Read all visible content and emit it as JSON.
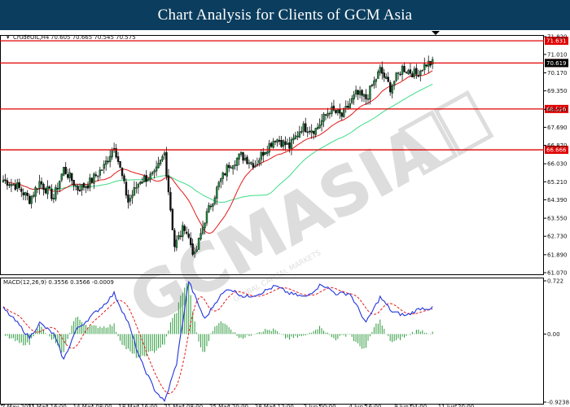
{
  "header": {
    "title": "Chart Analysis for Clients of GCM Asia"
  },
  "instrument": {
    "label": "CrudeOIL,H4",
    "ohlc": "70.605 70.665 70.545 70.575"
  },
  "macd": {
    "label": "MACD(12,26,9) 0.3556 0.3566 -0.0009"
  },
  "watermark": {
    "text": "GCMASIA",
    "sub": "GLOBAL CAPITAL MARKETS"
  },
  "chart_data": {
    "type": "candlestick",
    "title": "Chart Analysis for Clients of GCM Asia",
    "symbol": "CrudeOIL",
    "timeframe": "H4",
    "price_ticks": [
      "71.820",
      "71.010",
      "70.170",
      "69.350",
      "68.510",
      "67.690",
      "66.870",
      "66.030",
      "65.210",
      "64.390",
      "63.550",
      "62.730",
      "61.890",
      "61.070"
    ],
    "ylim": [
      61.07,
      71.82
    ],
    "x_ticks": [
      "7 May 2021",
      "11 May 16:00",
      "14 May 08:00",
      "18 May 16:00",
      "21 May 08:00",
      "25 May 20:00",
      "28 May 12:00",
      "2 Jun 00:00",
      "4 Jun 16:00",
      "9 Jun 04:00",
      "11 Jun 20:00"
    ],
    "levels": [
      {
        "value": 71.631,
        "label": "71.631"
      },
      {
        "value": 70.619,
        "label": "70.619"
      },
      {
        "value": 68.526,
        "label": "68.526"
      },
      {
        "value": 66.666,
        "label": "66.666"
      }
    ],
    "current_price": "70.619",
    "macd_ticks": [
      "0.722",
      "0.00",
      "-0.9238"
    ],
    "macd_ylim": [
      -0.9238,
      0.722
    ],
    "colors": {
      "bull": "#1f8a3c",
      "bear": "#111111",
      "level": "#e00000",
      "ma_fast": "#e31a1a",
      "ma_slow": "#3ddc84",
      "macd_line": "#2233dd",
      "signal_line": "#e31a1a",
      "histogram": "#2e9a3e"
    },
    "anchors_close": [
      [
        0,
        65.3
      ],
      [
        7,
        65.0
      ],
      [
        13,
        64.4
      ],
      [
        18,
        65.2
      ],
      [
        25,
        64.5
      ],
      [
        30,
        65.8
      ],
      [
        37,
        64.9
      ],
      [
        42,
        65.1
      ],
      [
        50,
        65.9
      ],
      [
        55,
        66.9
      ],
      [
        62,
        64.3
      ],
      [
        68,
        65.3
      ],
      [
        75,
        65.5
      ],
      [
        80,
        66.5
      ],
      [
        85,
        62.3
      ],
      [
        90,
        63.2
      ],
      [
        95,
        61.8
      ],
      [
        100,
        63.5
      ],
      [
        107,
        65.1
      ],
      [
        112,
        66.0
      ],
      [
        118,
        66.4
      ],
      [
        125,
        66.0
      ],
      [
        130,
        66.7
      ],
      [
        135,
        67.2
      ],
      [
        142,
        66.8
      ],
      [
        148,
        67.7
      ],
      [
        155,
        67.6
      ],
      [
        162,
        68.5
      ],
      [
        168,
        68.2
      ],
      [
        175,
        69.2
      ],
      [
        180,
        69.0
      ],
      [
        187,
        70.3
      ],
      [
        192,
        69.5
      ],
      [
        198,
        70.4
      ],
      [
        205,
        70.1
      ],
      [
        210,
        70.6
      ],
      [
        213,
        70.6
      ]
    ],
    "anchors_macd": [
      [
        0,
        0.35
      ],
      [
        7,
        0.15
      ],
      [
        13,
        -0.05
      ],
      [
        18,
        0.15
      ],
      [
        25,
        0.0
      ],
      [
        30,
        -0.35
      ],
      [
        36,
        0.05
      ],
      [
        42,
        0.2
      ],
      [
        50,
        0.4
      ],
      [
        55,
        0.55
      ],
      [
        62,
        0.15
      ],
      [
        68,
        -0.35
      ],
      [
        75,
        -0.75
      ],
      [
        80,
        -0.92
      ],
      [
        86,
        -0.4
      ],
      [
        92,
        0.72
      ],
      [
        96,
        0.45
      ],
      [
        100,
        0.2
      ],
      [
        107,
        0.5
      ],
      [
        112,
        0.62
      ],
      [
        120,
        0.5
      ],
      [
        127,
        0.55
      ],
      [
        135,
        0.65
      ],
      [
        142,
        0.55
      ],
      [
        150,
        0.5
      ],
      [
        158,
        0.68
      ],
      [
        165,
        0.55
      ],
      [
        172,
        0.55
      ],
      [
        180,
        0.15
      ],
      [
        187,
        0.5
      ],
      [
        193,
        0.3
      ],
      [
        200,
        0.25
      ],
      [
        207,
        0.35
      ],
      [
        213,
        0.35
      ]
    ]
  }
}
